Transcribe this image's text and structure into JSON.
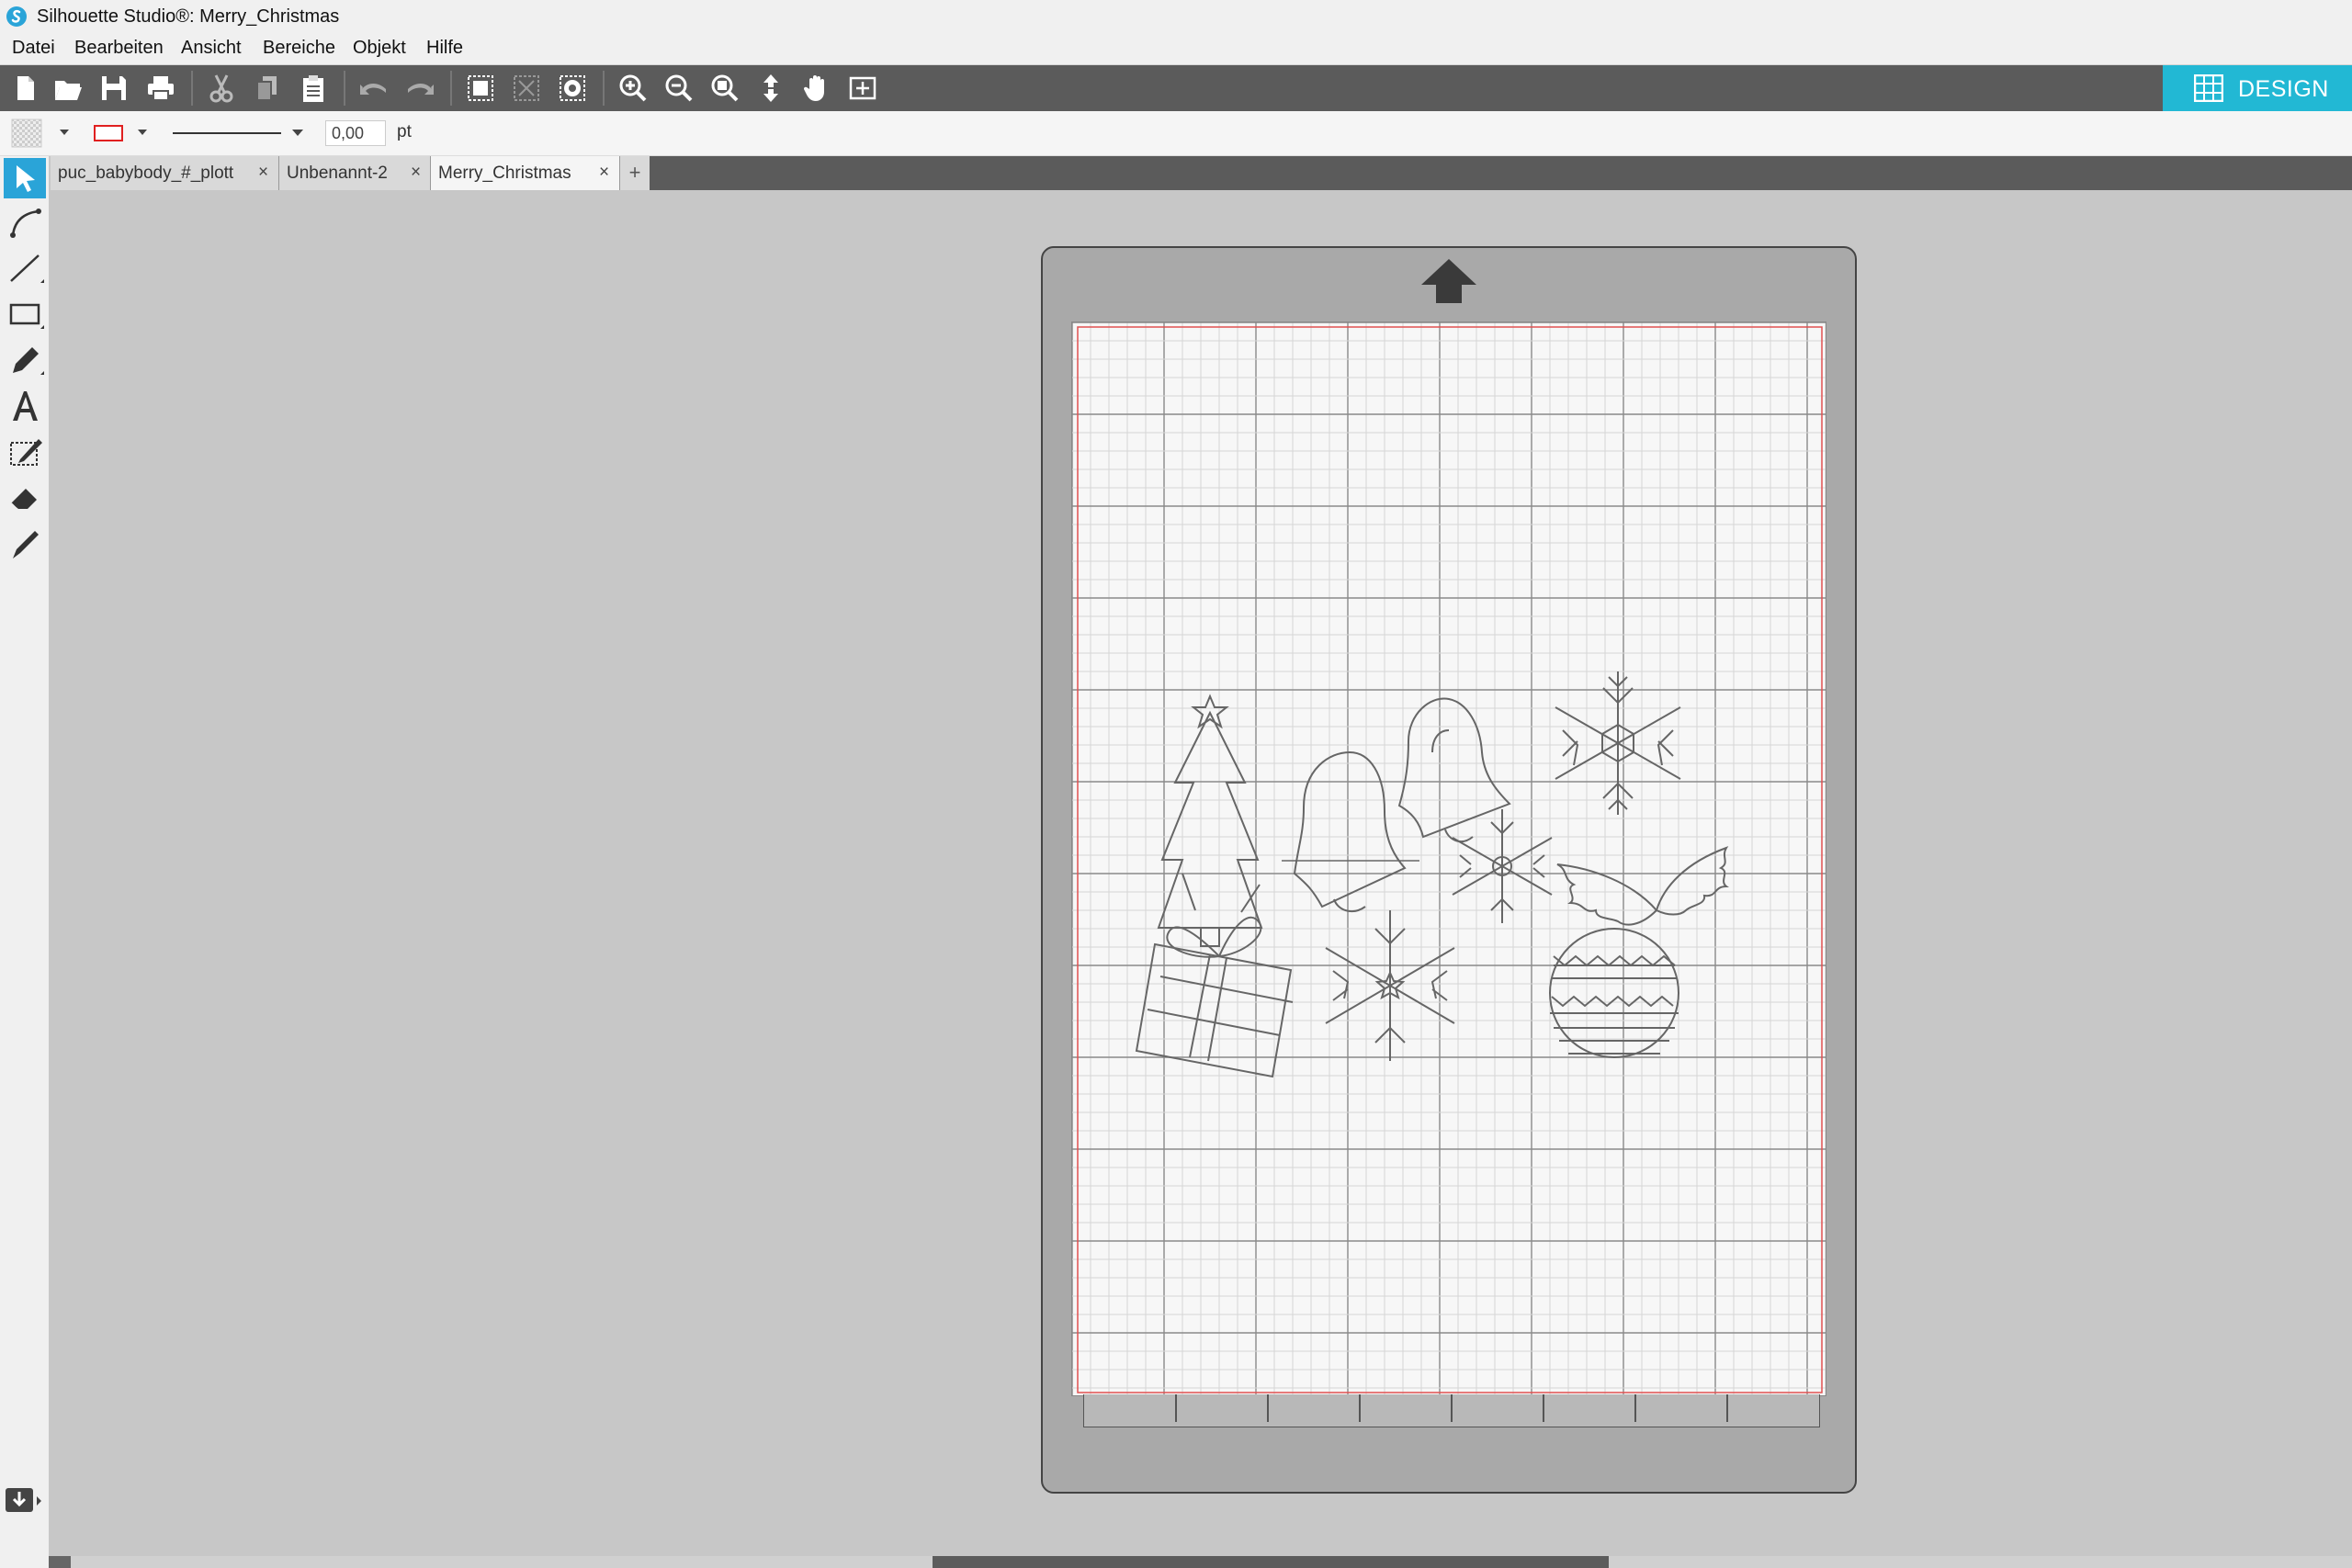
{
  "window": {
    "title": "Silhouette Studio®: Merry_Christmas"
  },
  "menu": {
    "items": [
      "Datei",
      "Bearbeiten",
      "Ansicht",
      "Bereiche",
      "Objekt",
      "Hilfe"
    ]
  },
  "toolbar": {
    "design_label": "DESIGN",
    "icons": [
      "new-document-icon",
      "open-folder-icon",
      "save-icon",
      "print-icon",
      "cut-icon",
      "copy-icon",
      "paste-icon",
      "undo-icon",
      "redo-icon",
      "group-icon",
      "ungroup-icon",
      "compound-path-icon",
      "zoom-in-icon",
      "zoom-out-icon",
      "zoom-selection-icon",
      "drag-zoom-icon",
      "pan-hand-icon",
      "fit-page-icon"
    ]
  },
  "properties": {
    "line_width": "0,00",
    "line_width_unit": "pt",
    "line_color": "#e02020"
  },
  "tabs": [
    {
      "label": "puc_babybody_#_plott",
      "active": false
    },
    {
      "label": "Unbenannt-2",
      "active": false
    },
    {
      "label": "Merry_Christmas",
      "active": true
    }
  ],
  "tab_add_label": "+",
  "tab_close_glyph": "×",
  "left_tools": [
    "select-arrow-icon",
    "edit-points-icon",
    "line-tool-icon",
    "rectangle-tool-icon",
    "pencil-tool-icon",
    "text-tool-icon",
    "knife-tool-icon",
    "eraser-tool-icon",
    "sketch-pen-icon"
  ],
  "canvas": {
    "designs": [
      "christmas-tree",
      "bells",
      "large-snowflake",
      "small-snowflake",
      "holly-leaves",
      "gift-box",
      "medium-snowflake",
      "ornament-ball"
    ]
  },
  "colors": {
    "accent": "#22b8d4",
    "toolbar": "#5b5b5b",
    "cut_border": "#e05050"
  }
}
